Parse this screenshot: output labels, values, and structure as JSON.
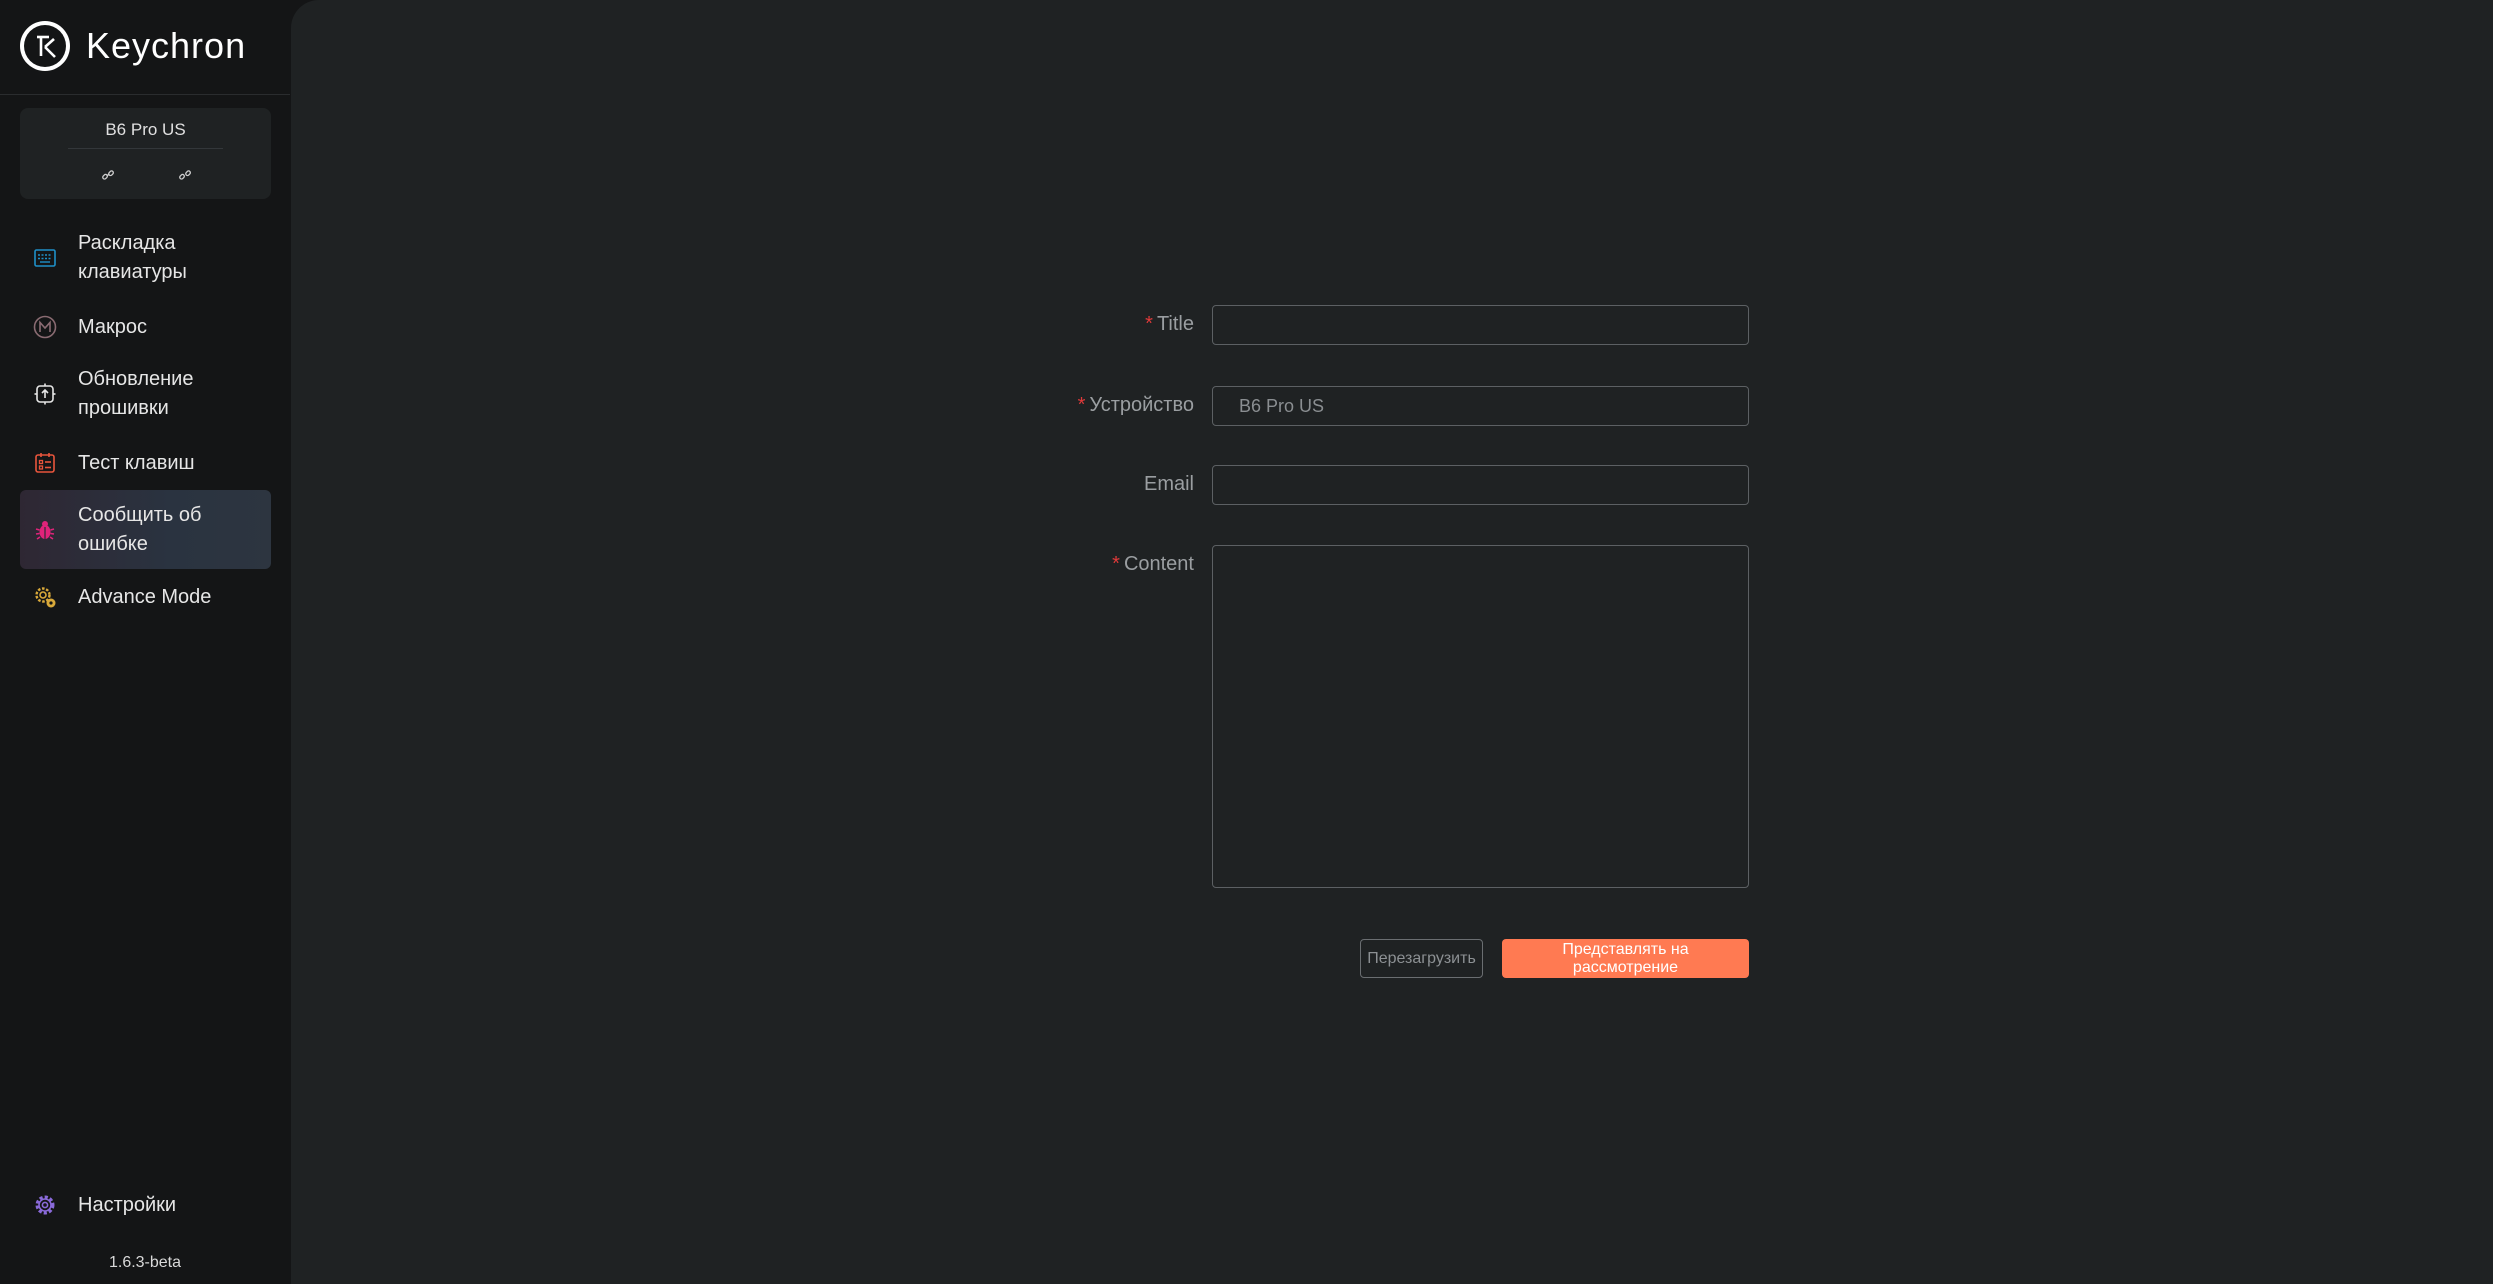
{
  "app": {
    "name": "Keychron",
    "version": "1.6.3-beta"
  },
  "device": {
    "name": "B6 Pro US"
  },
  "sidebar": {
    "items": [
      {
        "label_1": "Раскладка",
        "label_2": "клавиатуры",
        "icon": "keyboard-icon",
        "color": "#1e90c9"
      },
      {
        "label_1": "Макрос",
        "icon": "macro-m-icon",
        "color": "#8a6b72"
      },
      {
        "label_1": "Обновление",
        "label_2": "прошивки",
        "icon": "firmware-update-icon",
        "color": "#e6e6e6"
      },
      {
        "label_1": "Тест клавиш",
        "icon": "key-test-icon",
        "color": "#e8553c"
      },
      {
        "label_1": "Сообщить об",
        "label_2": "ошибке",
        "icon": "bug-icon",
        "color": "#e0237a",
        "active": true
      },
      {
        "label_1": "Advance Mode",
        "icon": "advance-mode-icon",
        "color": "#d9a93a"
      }
    ],
    "settings": {
      "label": "Настройки",
      "icon": "gear-icon",
      "color": "#8a6ad9"
    }
  },
  "form": {
    "title": {
      "label": "Title",
      "required": "*",
      "value": ""
    },
    "device": {
      "label": "Устройство",
      "required": "*",
      "value": "B6 Pro US"
    },
    "email": {
      "label": "Email",
      "value": ""
    },
    "content": {
      "label": "Content",
      "required": "*",
      "value": ""
    },
    "reset_label": "Перезагрузить",
    "submit_label": "Представлять на рассмотрение"
  },
  "colors": {
    "accent": "#ff7a52",
    "required": "#e03a3a",
    "main_bg": "#1f2223",
    "sidebar_bg": "#141516"
  }
}
